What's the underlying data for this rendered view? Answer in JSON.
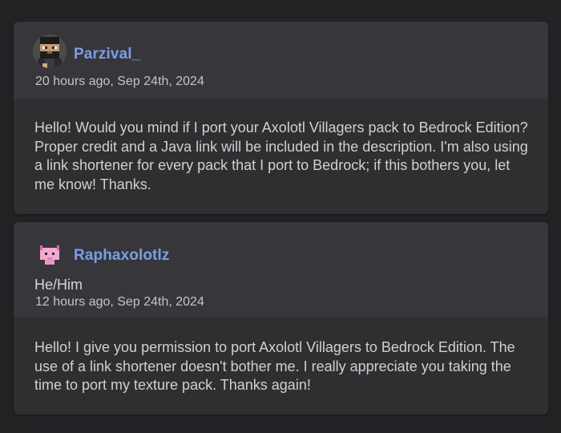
{
  "comments": [
    {
      "username": "Parzival_",
      "timestamp": "20 hours ago, Sep 24th, 2024",
      "avatar_icon": "pixel-bearded-man-avatar",
      "body": "Hello! Would you mind if I port your Axolotl Villagers pack to Bedrock Edition? Proper credit and a Java link will be included in the description. I'm also using a link shortener for every pack that I port to Bedrock; if this bothers you, let me know! Thanks."
    },
    {
      "username": "Raphaxolotlz",
      "pronouns": "He/Him",
      "timestamp": "12 hours ago, Sep 24th, 2024",
      "avatar_icon": "pixel-pink-axolotl-avatar",
      "body": "Hello! I give you permission to port Axolotl Villagers to Bedrock Edition. The use of a link shortener doesn't bother me. I really appreciate you taking the time to port my texture pack. Thanks again!"
    }
  ],
  "colors": {
    "page_background": "#222225",
    "card_background": "#2f2f32",
    "card_header": "#37373b",
    "username": "#7b9ee4",
    "text": "#d0d0d3"
  }
}
